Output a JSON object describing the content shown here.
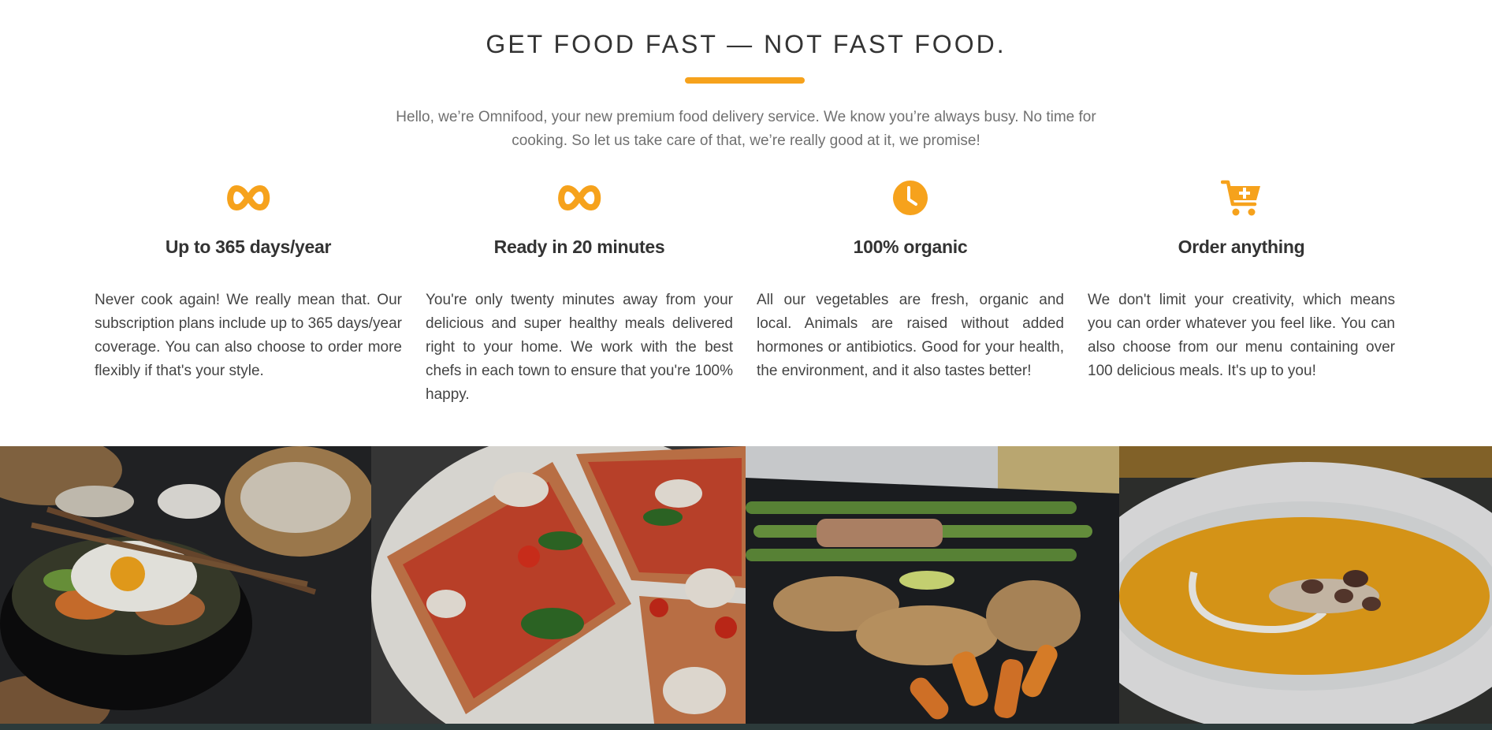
{
  "section": {
    "title": "GET FOOD FAST — NOT FAST FOOD.",
    "intro": "Hello, we’re Omnifood, your new premium food delivery service. We know you’re always busy. No time for cooking. So let us take care of that, we’re really good at it, we promise!"
  },
  "accent_color": "#f6a21c",
  "features": [
    {
      "icon": "infinity-icon",
      "title": "Up to 365 days/year",
      "text": "Never cook again! We really mean that. Our subscription plans include up to 365 days/year coverage. You can also choose to order more flexibly if that's your style."
    },
    {
      "icon": "infinity-icon",
      "title": "Ready in 20 minutes",
      "text": "You're only twenty minutes away from your delicious and super healthy meals delivered right to your home. We work with the best chefs in each town to ensure that you're 100% happy."
    },
    {
      "icon": "clock-icon",
      "title": "100% organic",
      "text": "All our vegetables are fresh, organic and local. Animals are raised without added hormones or antibiotics. Good for your health, the environment, and it also tastes better!"
    },
    {
      "icon": "cart-icon",
      "title": "Order anything",
      "text": "We don't limit your creativity, which means you can order whatever you feel like. You can also choose from our menu containing over 100 delicious meals. It's up to you!"
    }
  ]
}
